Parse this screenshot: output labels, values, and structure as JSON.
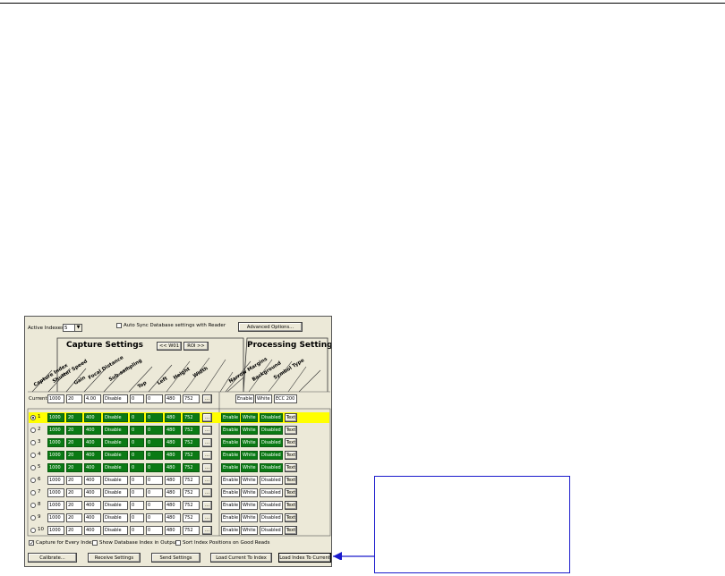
{
  "top": {
    "active_indexes_label": "Active Indexes",
    "active_indexes_value": "5",
    "auto_sync_label": "Auto Sync Database settings with Reader",
    "advanced_button": "Advanced Options..."
  },
  "sections": {
    "capture_title": "Capture Settings",
    "processing_title": "Processing Settings",
    "wo1_button": "<< W01",
    "roi_button": "ROI >>"
  },
  "capture_headers": [
    "Capture Index",
    "Shutter Speed",
    "Gain",
    "Focal Distance",
    "Sub-sampling",
    "Top",
    "Left",
    "Height",
    "Width"
  ],
  "processing_headers": [
    "Narrow Margins",
    "Background",
    "Symbol Type"
  ],
  "current_label": "Current",
  "current_capture": [
    "1000",
    "20",
    "4.00",
    "Disable",
    "0",
    "0",
    "480",
    "752"
  ],
  "current_processing": [
    "Enable",
    "White",
    "ECC 200"
  ],
  "rows": [
    {
      "index": "1",
      "capture": [
        "1000",
        "20",
        "400",
        "Disable",
        "0",
        "0",
        "480",
        "752"
      ],
      "processing": [
        "Enable",
        "White",
        "Disabled"
      ],
      "text": "Text",
      "active": true
    },
    {
      "index": "2",
      "capture": [
        "1000",
        "20",
        "400",
        "Disable",
        "0",
        "0",
        "480",
        "752"
      ],
      "processing": [
        "Enable",
        "White",
        "Disabled"
      ],
      "text": "Text",
      "active": false
    },
    {
      "index": "3",
      "capture": [
        "1000",
        "20",
        "400",
        "Disable",
        "0",
        "0",
        "480",
        "752"
      ],
      "processing": [
        "Enable",
        "White",
        "Disabled"
      ],
      "text": "Text",
      "active": false
    },
    {
      "index": "4",
      "capture": [
        "1000",
        "20",
        "400",
        "Disable",
        "0",
        "0",
        "480",
        "752"
      ],
      "processing": [
        "Enable",
        "White",
        "Disabled"
      ],
      "text": "Text",
      "active": false
    },
    {
      "index": "5",
      "capture": [
        "1000",
        "20",
        "400",
        "Disable",
        "0",
        "0",
        "480",
        "752"
      ],
      "processing": [
        "Enable",
        "White",
        "Disabled"
      ],
      "text": "Text",
      "active": false
    },
    {
      "index": "6",
      "capture": [
        "1000",
        "20",
        "400",
        "Disable",
        "0",
        "0",
        "480",
        "752"
      ],
      "processing": [
        "Enable",
        "White",
        "Disabled"
      ],
      "text": "Text",
      "active": false
    },
    {
      "index": "7",
      "capture": [
        "1000",
        "20",
        "400",
        "Disable",
        "0",
        "0",
        "480",
        "752"
      ],
      "processing": [
        "Enable",
        "White",
        "Disabled"
      ],
      "text": "Text",
      "active": false
    },
    {
      "index": "8",
      "capture": [
        "1000",
        "20",
        "400",
        "Disable",
        "0",
        "0",
        "480",
        "752"
      ],
      "processing": [
        "Enable",
        "White",
        "Disabled"
      ],
      "text": "Text",
      "active": false
    },
    {
      "index": "9",
      "capture": [
        "1000",
        "20",
        "400",
        "Disable",
        "0",
        "0",
        "480",
        "752"
      ],
      "processing": [
        "Enable",
        "White",
        "Disabled"
      ],
      "text": "Text",
      "active": false
    },
    {
      "index": "10",
      "capture": [
        "1000",
        "20",
        "400",
        "Disable",
        "0",
        "0",
        "480",
        "752"
      ],
      "processing": [
        "Enable",
        "White",
        "Disabled"
      ],
      "text": "Text",
      "active": false
    }
  ],
  "options": {
    "capture_every_label": "Capture for Every Index",
    "show_db_label": "Show Database Index in Output",
    "sort_label": "Sort Index Positions on Good Reads"
  },
  "buttons": {
    "calibrate": "Calibrate...",
    "receive": "Receive Settings",
    "send": "Send Settings",
    "load_current_to_index": "Load Current To Index",
    "load_index_to_current": "Load Index To Current"
  },
  "colors": {
    "enabled_cell": "#0a7a14",
    "highlight_row": "#ffff00",
    "callout": "#1a1acc"
  }
}
